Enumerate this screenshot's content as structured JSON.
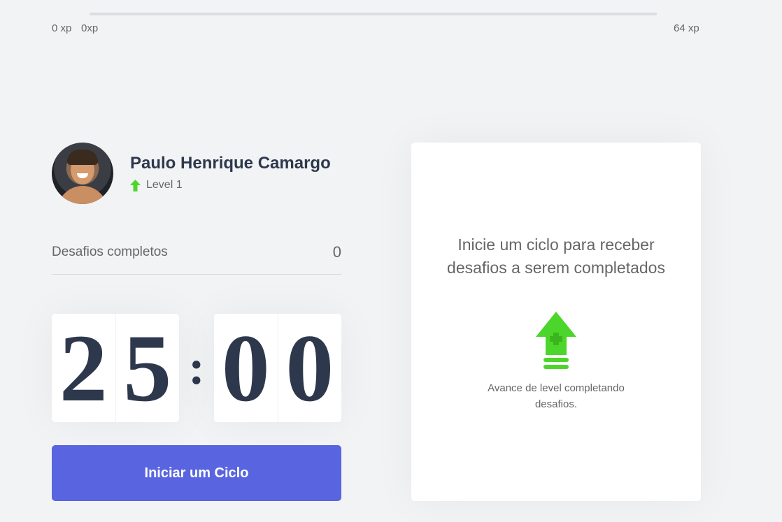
{
  "xp_bar": {
    "min_label": "0 xp",
    "current_label": "0xp",
    "max_label": "64 xp",
    "progress": 0
  },
  "profile": {
    "name": "Paulo Henrique Camargo",
    "level_label": "Level 1",
    "level_icon": "level-up-arrow-icon"
  },
  "completed": {
    "label": "Desafios completos",
    "count": "0"
  },
  "countdown": {
    "minute_left": "2",
    "minute_right": "5",
    "separator": ":",
    "second_left": "0",
    "second_right": "0"
  },
  "start_button": {
    "label": "Iniciar um Ciclo"
  },
  "challenge_box": {
    "title": "Inicie um ciclo para receber desafios a serem completados",
    "icon": "level-up-icon",
    "hint": "Avance de level completando desafios."
  },
  "colors": {
    "background": "#f2f3f5",
    "accent": "#5965e0",
    "green": "#4cd62b",
    "title": "#2e384d",
    "text": "#666666"
  }
}
